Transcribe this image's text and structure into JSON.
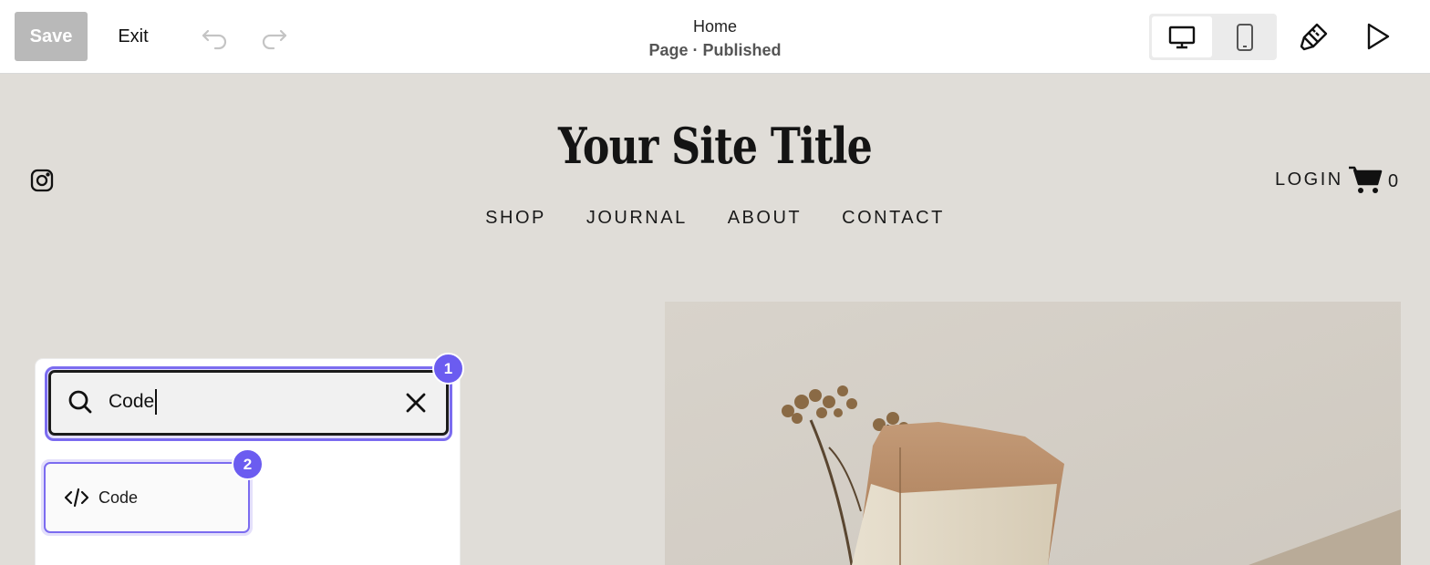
{
  "toolbar": {
    "save_label": "Save",
    "exit_label": "Exit",
    "page_title": "Home",
    "page_status": "Page · Published",
    "icons": [
      "undo-icon",
      "redo-icon",
      "desktop-icon",
      "mobile-icon",
      "brush-icon",
      "play-icon"
    ]
  },
  "site": {
    "title": "Your Site Title",
    "nav": [
      "SHOP",
      "JOURNAL",
      "ABOUT",
      "CONTACT"
    ],
    "login": "LOGIN",
    "cart_count": "0"
  },
  "search": {
    "value": "Code",
    "badge_1": "1"
  },
  "results": [
    {
      "label": "Code",
      "badge": "2",
      "icon": "code-icon"
    }
  ],
  "colors": {
    "accent": "#6b5cf0",
    "canvas_bg": "#e0ddd8",
    "save_disabled": "#b9b9b9"
  }
}
